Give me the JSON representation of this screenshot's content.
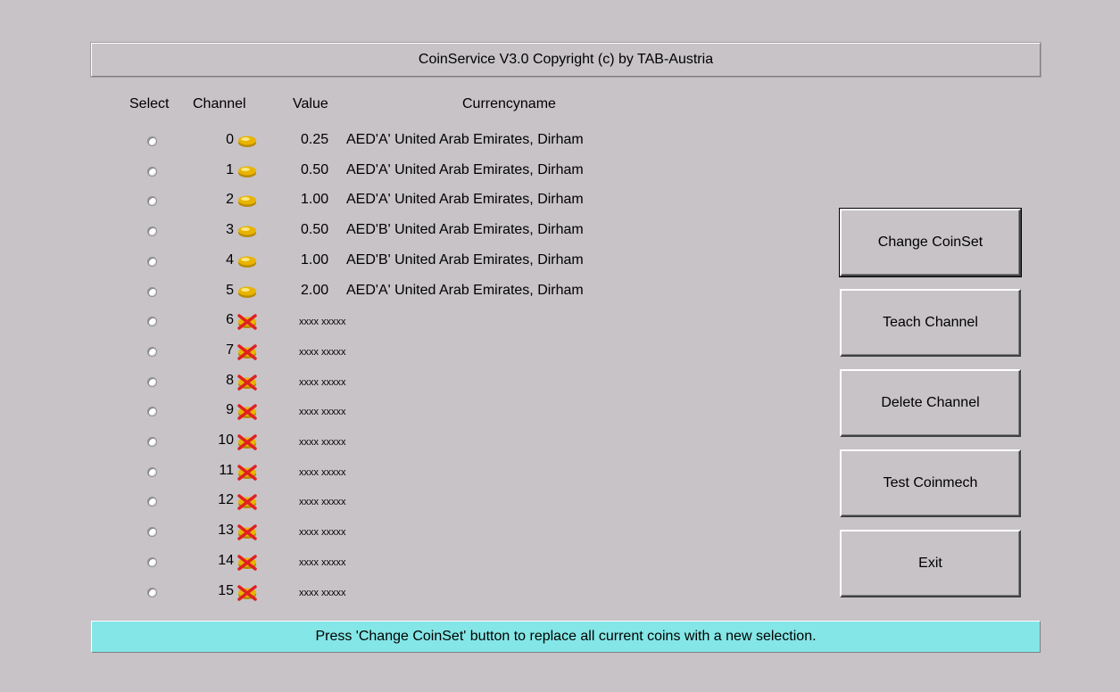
{
  "app": {
    "title": "CoinService V3.0 Copyright (c) by TAB-Austria"
  },
  "columns": {
    "select": "Select",
    "channel": "Channel",
    "value": "Value",
    "currency": "Currencyname"
  },
  "channels": [
    {
      "channel": "0",
      "icon": "coin-icon",
      "value": "0.25",
      "currency": "AED'A' United Arab Emirates, Dirham"
    },
    {
      "channel": "1",
      "icon": "coin-icon",
      "value": "0.50",
      "currency": "AED'A' United Arab Emirates, Dirham"
    },
    {
      "channel": "2",
      "icon": "coin-icon",
      "value": "1.00",
      "currency": "AED'A' United Arab Emirates, Dirham"
    },
    {
      "channel": "3",
      "icon": "coin-icon",
      "value": "0.50",
      "currency": "AED'B' United Arab Emirates, Dirham"
    },
    {
      "channel": "4",
      "icon": "coin-icon",
      "value": "1.00",
      "currency": "AED'B' United Arab Emirates, Dirham"
    },
    {
      "channel": "5",
      "icon": "coin-icon",
      "value": "2.00",
      "currency": "AED'A' United Arab Emirates, Dirham"
    },
    {
      "channel": "6",
      "icon": "empty-coin-icon",
      "placeholder": "xxxx xxxxx"
    },
    {
      "channel": "7",
      "icon": "empty-coin-icon",
      "placeholder": "xxxx xxxxx"
    },
    {
      "channel": "8",
      "icon": "empty-coin-icon",
      "placeholder": "xxxx xxxxx"
    },
    {
      "channel": "9",
      "icon": "empty-coin-icon",
      "placeholder": "xxxx xxxxx"
    },
    {
      "channel": "10",
      "icon": "empty-coin-icon",
      "placeholder": "xxxx xxxxx"
    },
    {
      "channel": "11",
      "icon": "empty-coin-icon",
      "placeholder": "xxxx xxxxx"
    },
    {
      "channel": "12",
      "icon": "empty-coin-icon",
      "placeholder": "xxxx xxxxx"
    },
    {
      "channel": "13",
      "icon": "empty-coin-icon",
      "placeholder": "xxxx xxxxx"
    },
    {
      "channel": "14",
      "icon": "empty-coin-icon",
      "placeholder": "xxxx xxxxx"
    },
    {
      "channel": "15",
      "icon": "empty-coin-icon",
      "placeholder": "xxxx xxxxx"
    }
  ],
  "buttons": {
    "change_coinset": "Change CoinSet",
    "teach_channel": "Teach Channel",
    "delete_channel": "Delete Channel",
    "test_coinmech": "Test Coinmech",
    "exit": "Exit"
  },
  "status": {
    "message": "Press 'Change CoinSet' button to replace all current coins with a new selection."
  },
  "colors": {
    "background": "#c7c3c7",
    "status_bar": "#84e6e6",
    "coin": "#e8b400",
    "empty_mark": "#e02020"
  }
}
